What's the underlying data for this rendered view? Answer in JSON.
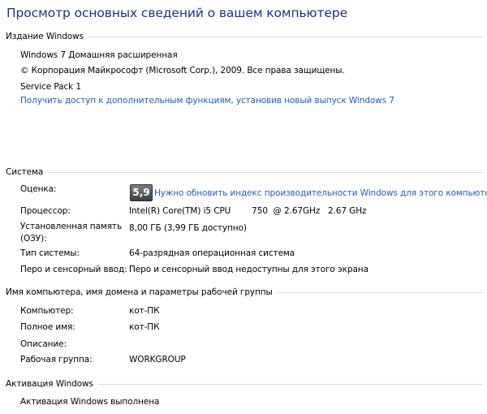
{
  "title": "Просмотр основных сведений о вашем компьютере",
  "edition": {
    "heading": "Издание Windows",
    "name": "Windows 7 Домашняя расширенная",
    "copyright": "© Корпорация Майкрософт (Microsoft Corp.), 2009. Все права защищены.",
    "service_pack": "Service Pack 1",
    "upgrade_link": "Получить доступ к дополнительным функциям, установив новый выпуск Windows 7"
  },
  "system": {
    "heading": "Система",
    "rating_label": "Оценка:",
    "rating_score": "5,9",
    "rating_link": "Нужно обновить индекс производительности Windows для этого компьютера",
    "processor_label": "Процессор:",
    "processor_value": "Intel(R) Core(TM) i5 CPU        750  @ 2.67GHz   2.67 GHz",
    "memory_label_1": "Установленная память",
    "memory_label_2": "(ОЗУ):",
    "memory_value": "8,00 ГБ (3,99 ГБ доступно)",
    "type_label": "Тип системы:",
    "type_value": "64-разрядная операционная система",
    "pen_label": "Перо и сенсорный ввод:",
    "pen_value": "Перо и сенсорный ввод недоступны для этого экрана"
  },
  "computer": {
    "heading": "Имя компьютера, имя домена и параметры рабочей группы",
    "name_label": "Компьютер:",
    "name_value": "кот-ПК",
    "fullname_label": "Полное имя:",
    "fullname_value": "кот-ПК",
    "description_label": "Описание:",
    "description_value": "",
    "workgroup_label": "Рабочая группа:",
    "workgroup_value": "WORKGROUP"
  },
  "activation": {
    "heading": "Активация Windows",
    "status": "Активация Windows выполнена"
  }
}
